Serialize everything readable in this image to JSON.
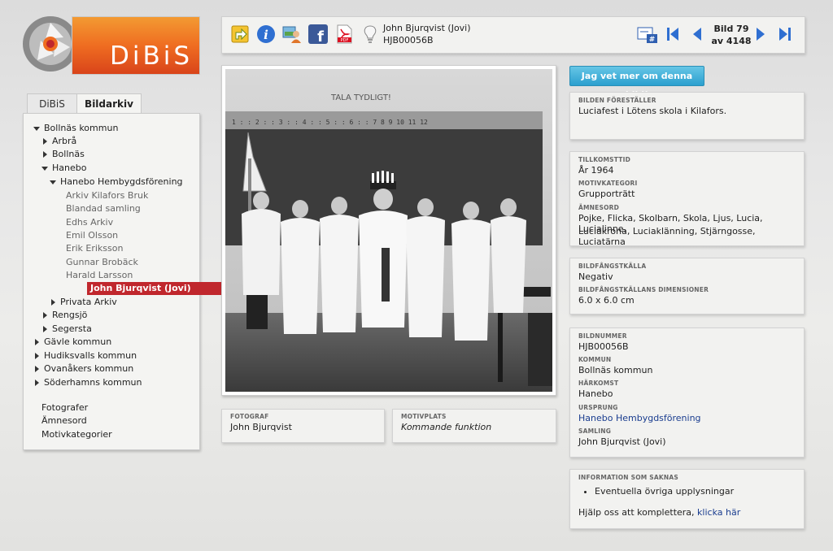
{
  "logo": {
    "text": "DiBiS"
  },
  "tabs": [
    {
      "label": "DiBiS"
    },
    {
      "label": "Bildarkiv"
    }
  ],
  "tree": {
    "bollnas": "Bollnäs kommun",
    "arbra": "Arbrå",
    "bollnas_sub": "Bollnäs",
    "hanebo": "Hanebo",
    "hembygd": "Hanebo Hembygdsförening",
    "leaves": [
      "Arkiv Kilafors Bruk",
      "Blandad samling",
      "Edhs Arkiv",
      "Emil Olsson",
      "Erik Eriksson",
      "Gunnar Brobäck",
      "Harald Larsson"
    ],
    "selected": "John Bjurqvist (Jovi)",
    "privata": "Privata Arkiv",
    "rengsjo": "Rengsjö",
    "segersta": "Segersta",
    "gavle": "Gävle kommun",
    "hudiksvall": "Hudiksvalls kommun",
    "ovanaker": "Ovanåkers kommun",
    "soderhamn": "Söderhamns kommun"
  },
  "bottom_links": [
    "Fotografer",
    "Ämnesord",
    "Motivkategorier"
  ],
  "toolbar": {
    "title": "John Bjurqvist (Jovi)",
    "image_id": "HJB00056B",
    "counter_line1": "Bild 79",
    "counter_line2": "av 4148"
  },
  "photo": {
    "board_text": "TALA TYDLIGT!"
  },
  "fotograf": {
    "label": "FOTOGRAF",
    "value": "John Bjurqvist"
  },
  "motivplats": {
    "label": "MOTIVPLATS",
    "value": "Kommande funktion"
  },
  "know_more_button": "Jag vet mer om denna bild!",
  "box1": {
    "label": "BILDEN FÖRESTÄLLER",
    "value": "Luciafest i Lötens skola i Kilafors."
  },
  "box2": {
    "tillkomsttid_label": "TILLKOMSTTID",
    "tillkomsttid": "År 1964",
    "motivkategori_label": "MOTIVKATEGORI",
    "motivkategori": "Grupporträtt",
    "amnesord_label": "ÄMNESORD",
    "amnesord_line1": "Pojke, Flicka, Skolbarn, Skola, Ljus, Lucia, Lucialinne,",
    "amnesord_line2": "Luciakrona, Luciaklänning, Stjärngosse, Luciatärna"
  },
  "box3": {
    "kalla_label": "BILDFÅNGSTKÄLLA",
    "kalla": "Negativ",
    "dim_label": "BILDFÅNGSTKÄLLANS DIMENSIONER",
    "dim": "6.0 x 6.0 cm"
  },
  "box4": {
    "nummer_label": "BILDNUMMER",
    "nummer": "HJB00056B",
    "kommun_label": "KOMMUN",
    "kommun": "Bollnäs kommun",
    "harkomst_label": "HÄRKOMST",
    "harkomst": "Hanebo",
    "ursprung_label": "URSPRUNG",
    "ursprung": "Hanebo Hembygdsförening",
    "samling_label": "SAMLING",
    "samling": "John Bjurqvist (Jovi)"
  },
  "box5": {
    "label": "INFORMATION SOM SAKNAS",
    "item": "Eventuella övriga upplysningar",
    "help_text": "Hjälp oss att komplettera,",
    "help_link": "klicka här"
  },
  "colors": {
    "accent_red": "#c0272d",
    "button_blue": "#2b9fcf",
    "logo_orange": "#ef6d21"
  }
}
